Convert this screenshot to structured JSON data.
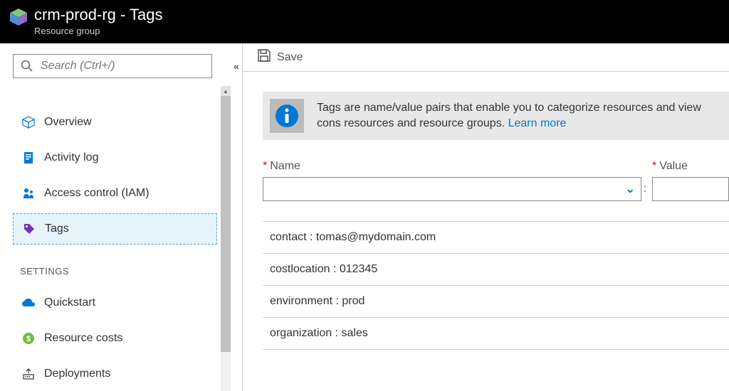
{
  "header": {
    "title": "crm-prod-rg - Tags",
    "subtitle": "Resource group"
  },
  "sidebar": {
    "search_placeholder": "Search (Ctrl+/)",
    "items": [
      {
        "label": "Overview",
        "icon": "cube"
      },
      {
        "label": "Activity log",
        "icon": "log"
      },
      {
        "label": "Access control (IAM)",
        "icon": "iam"
      },
      {
        "label": "Tags",
        "icon": "tag",
        "selected": true
      }
    ],
    "section_header": "SETTINGS",
    "settings_items": [
      {
        "label": "Quickstart",
        "icon": "cloud"
      },
      {
        "label": "Resource costs",
        "icon": "cost"
      },
      {
        "label": "Deployments",
        "icon": "deploy"
      }
    ]
  },
  "toolbar": {
    "save_label": "Save"
  },
  "info": {
    "text": "Tags are name/value pairs that enable you to categorize resources and view cons resources and resource groups.",
    "link": "Learn more"
  },
  "form": {
    "name_label": "Name",
    "value_label": "Value"
  },
  "tags": [
    {
      "display": "contact : tomas@mydomain.com"
    },
    {
      "display": "costlocation : 012345"
    },
    {
      "display": "environment : prod"
    },
    {
      "display": "organization : sales"
    }
  ]
}
